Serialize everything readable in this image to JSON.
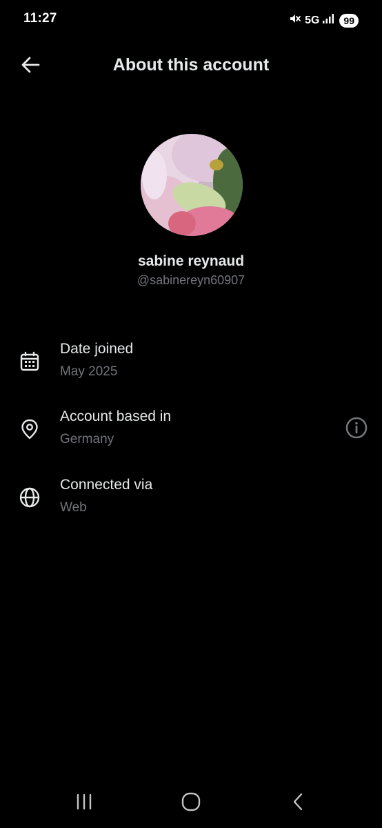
{
  "status_bar": {
    "time": "11:27",
    "network": "5G",
    "battery": "99",
    "icons": [
      "mute-icon",
      "signal-icon"
    ]
  },
  "header": {
    "title": "About this account",
    "back_icon": "arrow-left-icon"
  },
  "profile": {
    "name": "sabine reynaud",
    "handle": "@sabinereyn60907"
  },
  "rows": [
    {
      "label": "Date joined",
      "value": "May 2025",
      "icon": "calendar-icon"
    },
    {
      "label": "Account based in",
      "value": "Germany",
      "icon": "location-pin-icon",
      "info_icon": "info-icon"
    },
    {
      "label": "Connected via",
      "value": "Web",
      "icon": "globe-icon"
    }
  ],
  "nav": {
    "icons": [
      "recent-apps-icon",
      "home-icon",
      "back-icon"
    ]
  },
  "colors": {
    "background": "#000000",
    "primary_text": "#e7e9ea",
    "secondary_text": "#71767b"
  }
}
